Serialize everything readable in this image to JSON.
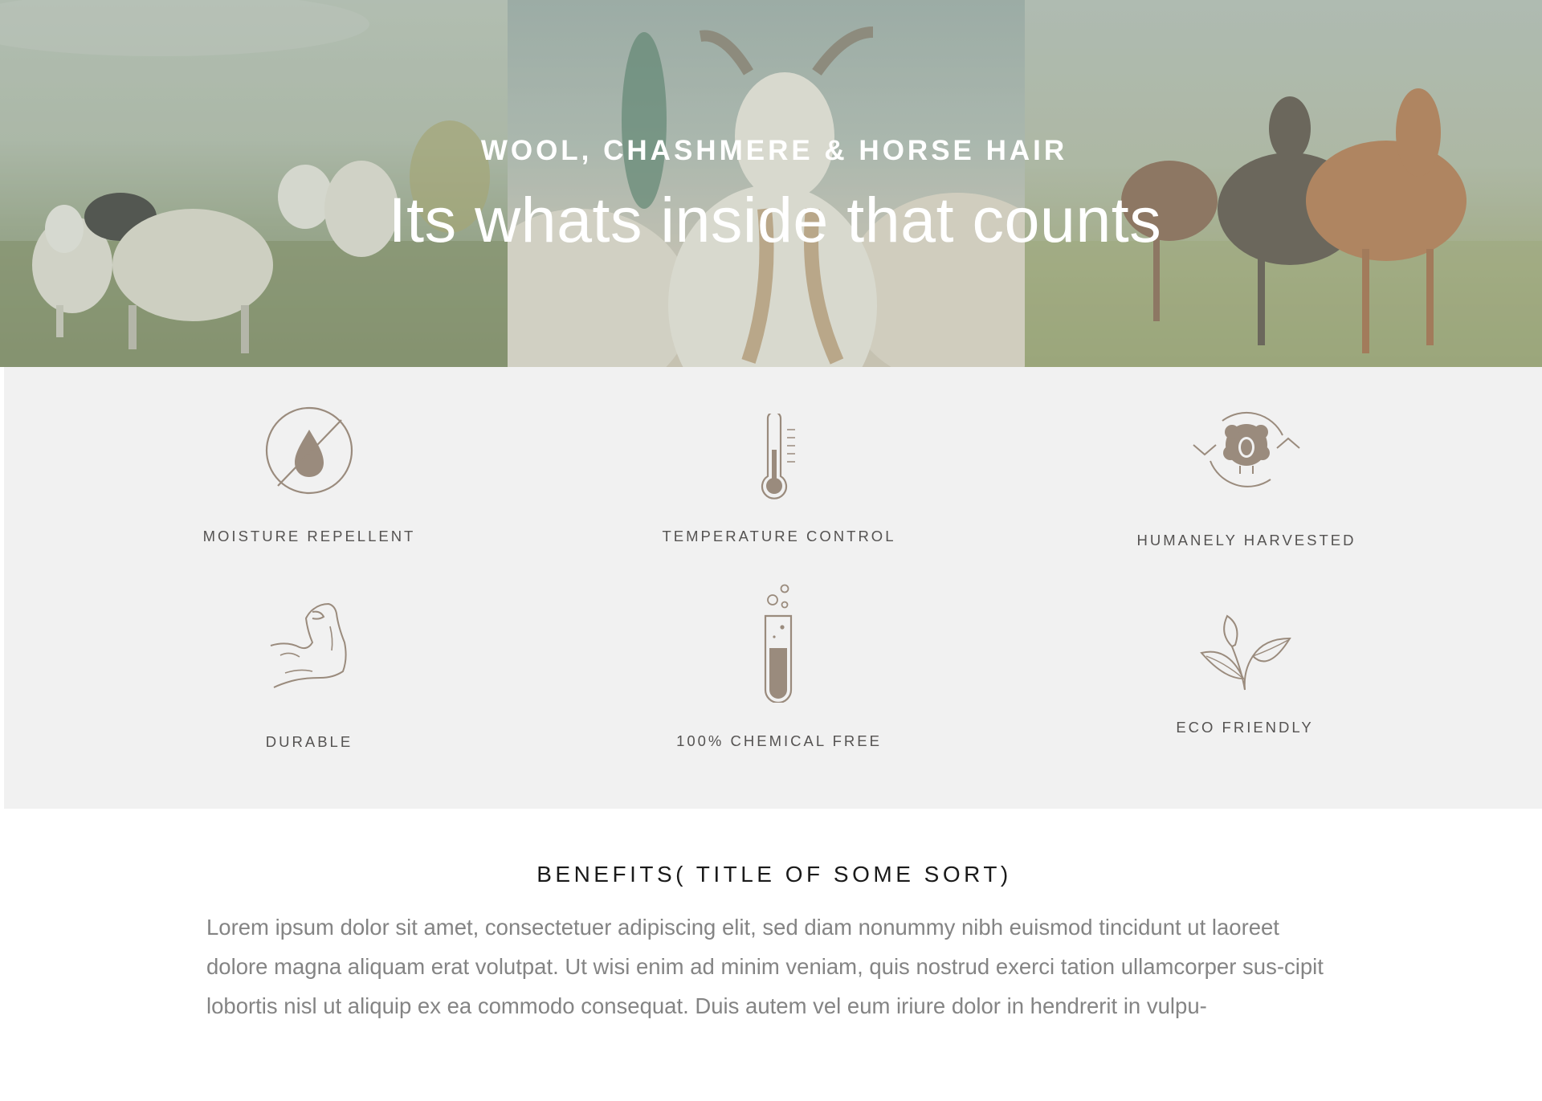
{
  "hero": {
    "subtitle": "WOOL, CHASHMERE & HORSE HAIR",
    "title": "Its whats inside that counts",
    "images": [
      "sheep-photo",
      "goat-photo",
      "horses-photo"
    ]
  },
  "features": [
    {
      "icon": "no-water-drop-icon",
      "label": "MOISTURE REPELLENT"
    },
    {
      "icon": "thermometer-icon",
      "label": "TEMPERATURE CONTROL"
    },
    {
      "icon": "sheep-cycle-icon",
      "label": "HUMANELY HARVESTED"
    },
    {
      "icon": "flexed-arm-icon",
      "label": "DURABLE"
    },
    {
      "icon": "test-tube-icon",
      "label": "100% CHEMICAL FREE"
    },
    {
      "icon": "leaves-icon",
      "label": "ECO FRIENDLY"
    }
  ],
  "benefits": {
    "title": "BENEFITS( TITLE OF SOME SORT)",
    "body": "Lorem ipsum dolor sit amet, consectetuer adipiscing elit, sed diam nonummy nibh euismod tincidunt ut laoreet dolore magna aliquam erat volutpat. Ut wisi enim ad minim veniam, quis nostrud exerci tation ullamcorper sus-cipit lobortis nisl ut aliquip ex ea commodo consequat. Duis autem vel eum iriure dolor in hendrerit in vulpu-"
  },
  "colors": {
    "icon": "#9a8b7d",
    "feature_bg": "#f1f1f1",
    "label": "#555352",
    "body_text": "#848484"
  }
}
